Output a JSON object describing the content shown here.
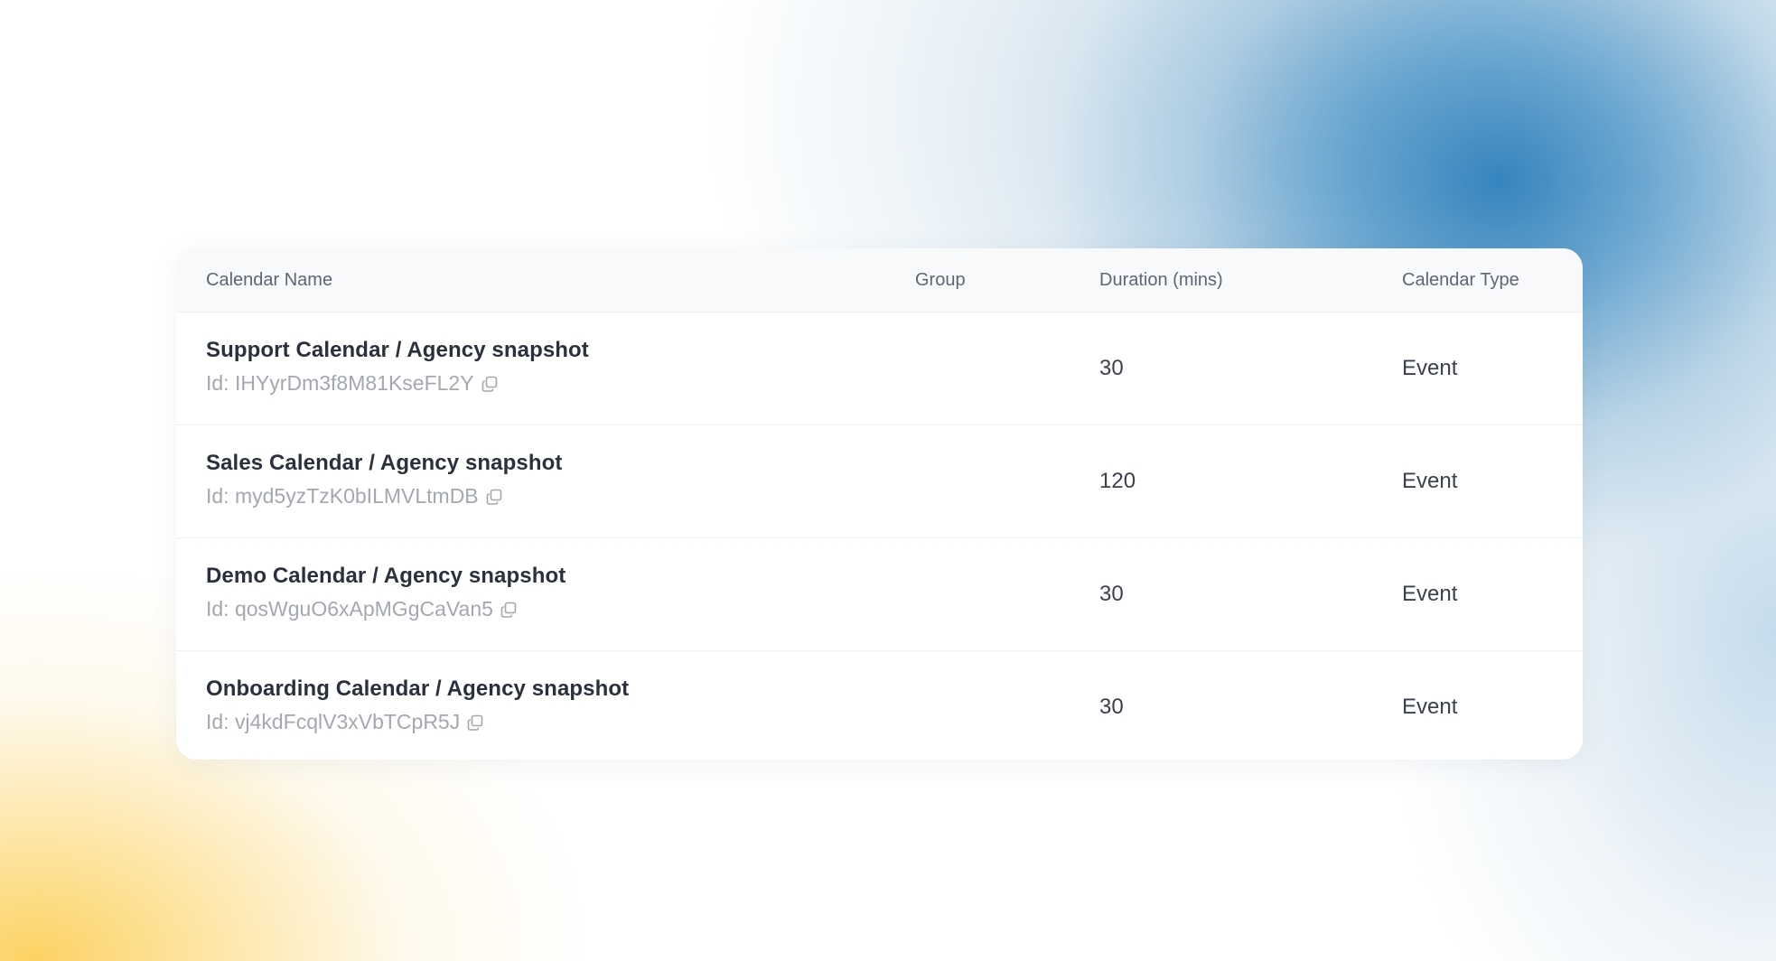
{
  "table": {
    "headers": {
      "name": "Calendar Name",
      "group": "Group",
      "duration": "Duration (mins)",
      "type": "Calendar Type"
    },
    "rows": [
      {
        "title": "Support Calendar / Agency snapshot",
        "id": "Id: IHYyrDm3f8M81KseFL2Y",
        "group": "",
        "duration": "30",
        "type": "Event"
      },
      {
        "title": "Sales Calendar / Agency snapshot",
        "id": "Id: myd5yzTzK0bILMVLtmDB",
        "group": "",
        "duration": "120",
        "type": "Event"
      },
      {
        "title": "Demo Calendar / Agency snapshot",
        "id": "Id: qosWguO6xApMGgCaVan5",
        "group": "",
        "duration": "30",
        "type": "Event"
      },
      {
        "title": "Onboarding Calendar / Agency snapshot",
        "id": "Id: vj4kdFcqlV3xVbTCpR5J",
        "group": "",
        "duration": "30",
        "type": "Event"
      }
    ],
    "icons": {
      "copy": "copy-icon"
    }
  },
  "colors": {
    "title_text": "#2a313c",
    "id_text": "#a3a8b0",
    "header_text": "#5f6672",
    "header_bg": "#f8f9fb",
    "accent_blue": "#2e80bc",
    "accent_yellow": "#fcd05a"
  }
}
